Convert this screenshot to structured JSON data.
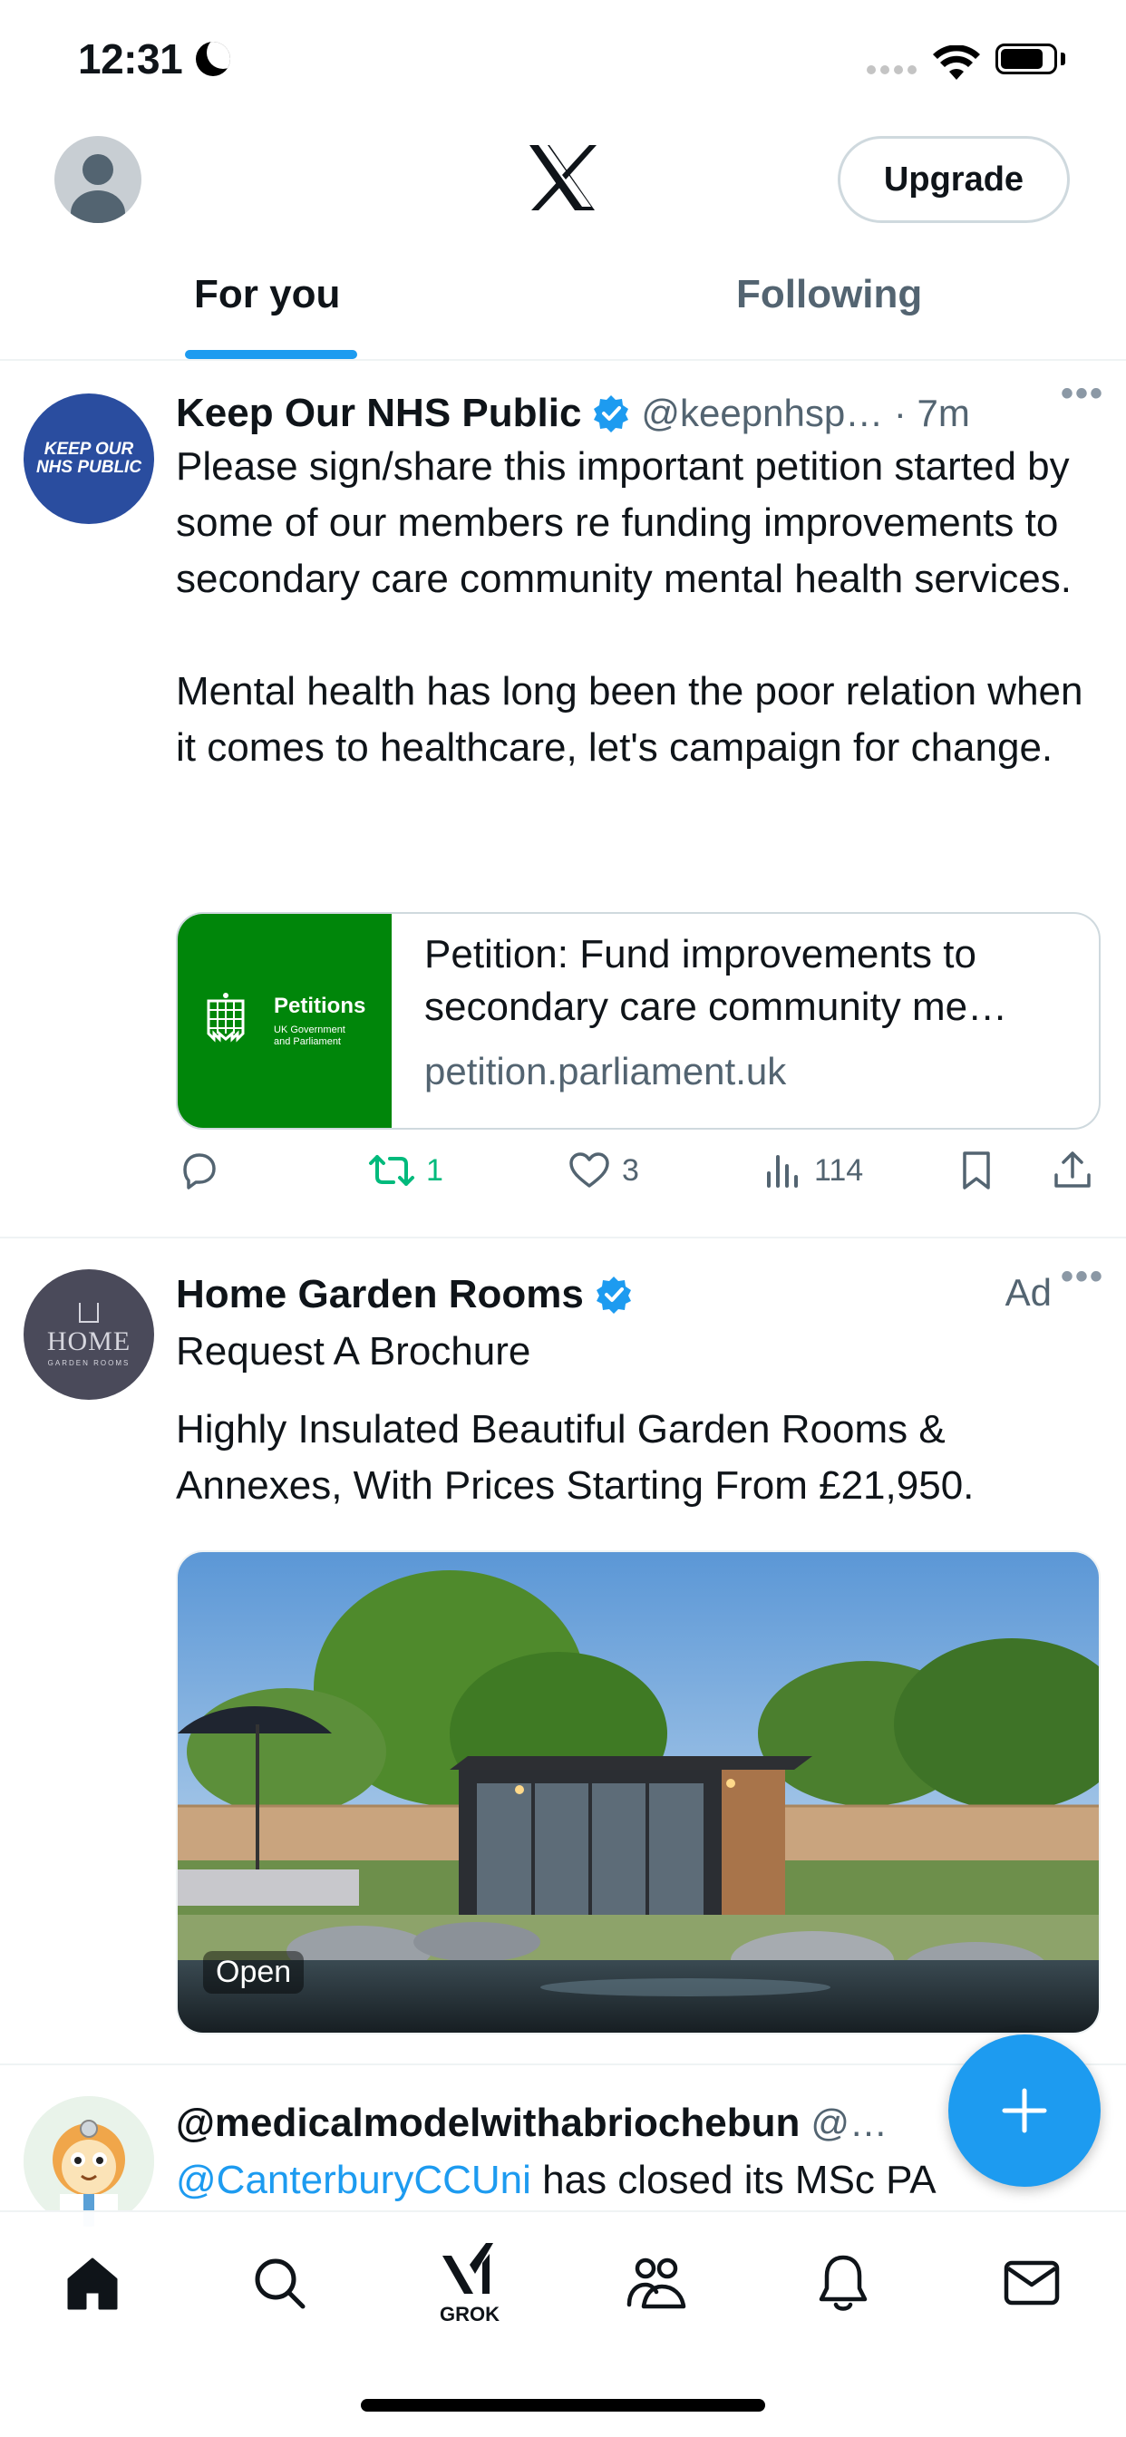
{
  "status_bar": {
    "time": "12:31"
  },
  "header": {
    "upgrade_label": "Upgrade",
    "tabs": [
      {
        "label": "For you",
        "active": true
      },
      {
        "label": "Following",
        "active": false
      }
    ],
    "accent_color": "#1d9bf0"
  },
  "posts": [
    {
      "author": "Keep Our NHS Public",
      "avatar_text": [
        "KEEP OUR",
        "NHS PUBLIC"
      ],
      "handle_time": "@keepnhsp… · 7m",
      "text": "Please sign/share this important petition started by some of our members re funding improvements to secondary care community mental health services.\n\nMental health has long been the poor relation when it comes to healthcare, let's campaign for change.",
      "card": {
        "thumb_title": "Petitions",
        "thumb_subtitle": "UK Government and Parliament",
        "title": "Petition: Fund improvements to secondary care community me…",
        "domain": "petition.parliament.uk"
      },
      "stats": {
        "retweets": "1",
        "likes": "3",
        "views": "114"
      }
    },
    {
      "author": "Home Garden Rooms",
      "avatar_text": [
        "HOME",
        "GARDEN ROOMS"
      ],
      "ad_label": "Ad",
      "headline": "Request A Brochure",
      "text": "Highly Insulated Beautiful Garden Rooms & Annexes, With Prices Starting From £21,950.",
      "media_badge": "Open"
    },
    {
      "author": "@medicalmodelwithabriochebun",
      "handle_time": "@…",
      "mention": "@CanterburyCCUni",
      "text": " has closed its MSc PA"
    }
  ],
  "bottom_nav": {
    "grok_label": "GROK",
    "items": [
      "home-icon",
      "search-icon",
      "grok-icon",
      "communities-icon",
      "notifications-icon",
      "messages-icon"
    ]
  }
}
